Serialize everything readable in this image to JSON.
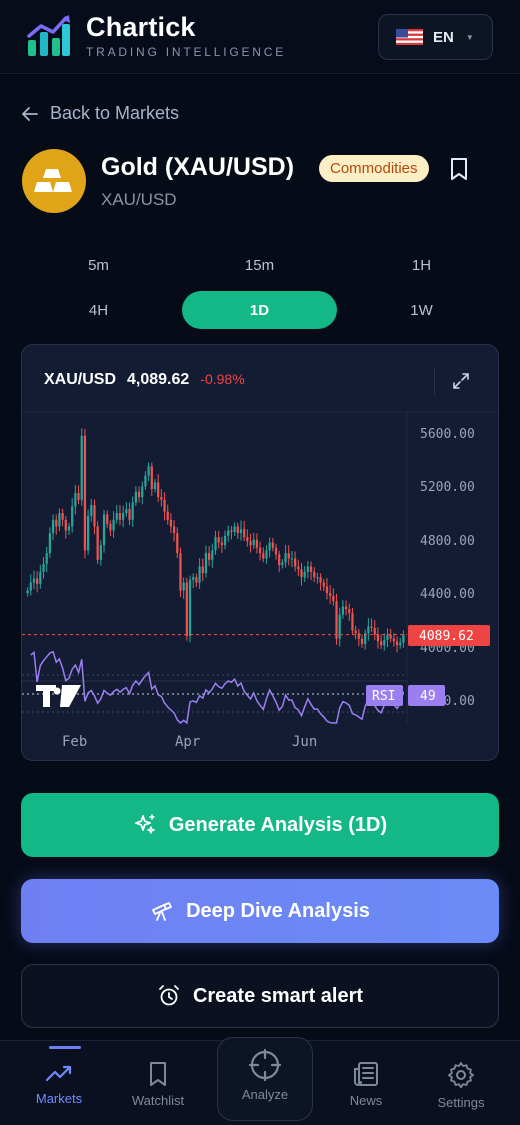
{
  "app": {
    "brand_name": "Chartick",
    "brand_tagline": "TRADING INTELLIGENCE",
    "language": "EN"
  },
  "nav": {
    "back_label": "Back to Markets"
  },
  "asset": {
    "title": "Gold (XAU/USD)",
    "category_badge": "Commodities",
    "symbol": "XAU/USD",
    "icon": "gold-bars-icon"
  },
  "timeframes": [
    {
      "label": "5m",
      "active": false
    },
    {
      "label": "15m",
      "active": false
    },
    {
      "label": "1H",
      "active": false
    },
    {
      "label": "4H",
      "active": false
    },
    {
      "label": "1D",
      "active": true
    },
    {
      "label": "1W",
      "active": false
    }
  ],
  "chart": {
    "symbol": "XAU/USD",
    "price": "4,089.62",
    "change": "-0.98%",
    "price_tag": "4089.62",
    "price_axis": [
      "5600.00",
      "5200.00",
      "4800.00",
      "4400.00",
      "4000.00",
      "3600.00"
    ],
    "time_axis": [
      "Feb",
      "Apr",
      "Jun"
    ],
    "rsi_label": "RSI",
    "rsi_value": "49",
    "colors": {
      "up": "#26a69a",
      "down": "#ef5350",
      "rsi": "#9b7ff0"
    }
  },
  "chart_data": {
    "type": "candlestick",
    "x": [
      "Feb",
      "Apr",
      "Jun"
    ],
    "ylim": [
      3600,
      5700
    ],
    "last_price": 4089.62,
    "indicator": {
      "name": "RSI",
      "last_value": 49
    },
    "close": [
      4420,
      4480,
      4510,
      4470,
      4560,
      4620,
      4700,
      4850,
      4950,
      4900,
      5000,
      4950,
      4870,
      4900,
      5050,
      5150,
      5100,
      5580,
      4720,
      4980,
      5060,
      4900,
      4650,
      4760,
      4990,
      4920,
      4870,
      4950,
      5000,
      4950,
      5000,
      5030,
      4950,
      5080,
      5160,
      5120,
      5200,
      5280,
      5350,
      5180,
      5230,
      5120,
      5100,
      5010,
      4950,
      4900,
      4850,
      4700,
      4420,
      4480,
      4080,
      4500,
      4520,
      4480,
      4600,
      4550,
      4700,
      4650,
      4720,
      4820,
      4780,
      4760,
      4830,
      4870,
      4860,
      4900,
      4850,
      4880,
      4820,
      4790,
      4760,
      4800,
      4740,
      4700,
      4660,
      4720,
      4780,
      4740,
      4690,
      4610,
      4630,
      4700,
      4660,
      4660,
      4600,
      4580,
      4520,
      4560,
      4600,
      4560,
      4520,
      4520,
      4480,
      4450,
      4400,
      4380,
      4340,
      4060,
      4240,
      4300,
      4280,
      4250,
      4120,
      4100,
      4060,
      4020,
      4100,
      4150,
      4140,
      4090,
      4040,
      4010,
      4050,
      4090,
      4060,
      4040,
      4010,
      4030,
      4090
    ]
  },
  "actions": {
    "generate": "Generate Analysis (1D)",
    "deep_dive": "Deep Dive Analysis",
    "alert": "Create smart alert"
  },
  "bottom_nav": [
    {
      "label": "Markets",
      "icon": "trending-up-icon",
      "active": true
    },
    {
      "label": "Watchlist",
      "icon": "bookmark-icon",
      "active": false
    },
    {
      "label": "Analyze",
      "icon": "crosshair-icon",
      "active": false
    },
    {
      "label": "News",
      "icon": "newspaper-icon",
      "active": false
    },
    {
      "label": "Settings",
      "icon": "gear-icon",
      "active": false
    }
  ]
}
